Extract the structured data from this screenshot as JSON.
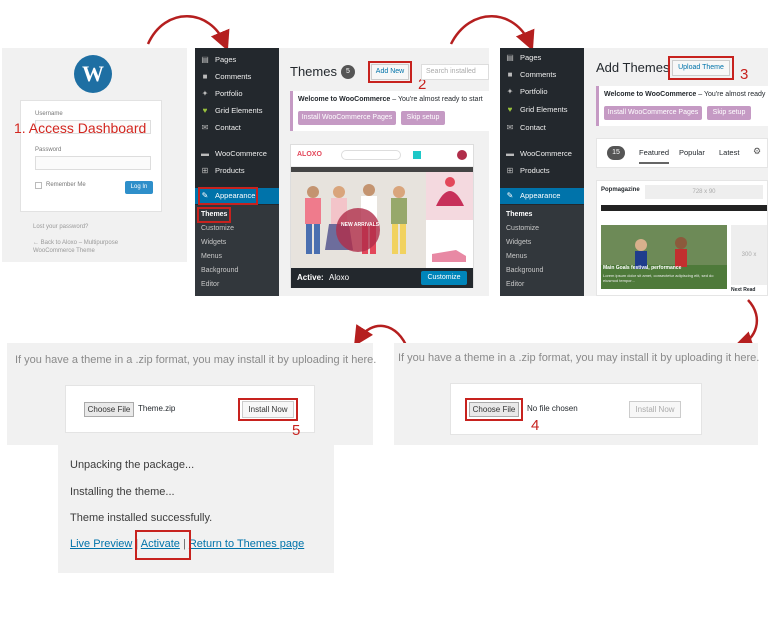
{
  "login": {
    "logo": "W",
    "username_label": "Username",
    "password_label": "Password",
    "remember_label": "Remember Me",
    "login_button": "Log In",
    "step_label": "1. Access Dashboard",
    "lost_password": "Lost your password?",
    "back_link": "← Back to Aloxo – Multipurpose WooCommerce Theme"
  },
  "sidebar1": {
    "items": [
      "Pages",
      "Comments",
      "Portfolio",
      "Grid Elements",
      "Contact",
      "WooCommerce",
      "Products",
      "Appearance"
    ],
    "sub_items": [
      "Themes",
      "Customize",
      "Widgets",
      "Menus",
      "Background",
      "Editor"
    ]
  },
  "sidebar2": {
    "items": [
      "Pages",
      "Comments",
      "Portfolio",
      "Grid Elements",
      "Contact",
      "WooCommerce",
      "Products",
      "Appearance"
    ],
    "sub_items": [
      "Themes",
      "Customize",
      "Widgets",
      "Menus",
      "Background",
      "Editor"
    ]
  },
  "themes_panel": {
    "title": "Themes",
    "count": "5",
    "add_new": "Add New",
    "search_placeholder": "Search installed",
    "step_num": "2",
    "welcome_bold": "Welcome to WooCommerce",
    "welcome_rest": " – You're almost ready to start",
    "install_pages": "Install WooCommerce Pages",
    "skip_setup": "Skip setup",
    "active_label": "Active:",
    "active_theme": "Aloxo",
    "customize": "Customize",
    "shop_logo": "ALOXO",
    "new_arrivals": "NEW ARRIVALS"
  },
  "add_themes_panel": {
    "title": "Add Themes",
    "upload_theme": "Upload Theme",
    "step_num": "3",
    "welcome_bold": "Welcome to WooCommerce",
    "welcome_rest": " – You're almost ready",
    "install_pages": "Install WooCommerce Pages",
    "skip_setup": "Skip setup",
    "count": "15",
    "tabs": [
      "Featured",
      "Popular",
      "Latest"
    ],
    "pm_logo": "Popmagazine",
    "ad1": "728 x 90",
    "ad2": "300 x",
    "news_headline": "Main Goals festival, performance",
    "news_text": "Lorem ipsum dolor sit amet, consectetur adipiscing elit, sed do eiusmod tempor...",
    "next_read": "Next Read"
  },
  "upload_left": {
    "text": "If you have a theme in a .zip format, you may install it by uploading it here.",
    "choose_file": "Choose File",
    "file_name": "Theme.zip",
    "install_now": "Install Now",
    "step_num": "5"
  },
  "upload_right": {
    "text": "If you have a theme in a .zip format, you may install it by uploading it here.",
    "choose_file": "Choose File",
    "file_name": "No file chosen",
    "install_now": "Install Now",
    "step_num": "4"
  },
  "result": {
    "line1": "Unpacking the package...",
    "line2": "Installing the theme...",
    "line3": "Theme installed successfully.",
    "live_preview": "Live Preview",
    "activate": "Activate",
    "return_link": "Return to Themes page",
    "sep": "|"
  },
  "colors": {
    "accent": "#0073aa",
    "highlight_red": "#c7221e",
    "woo_purple": "#c59ac4",
    "sidebar_dark": "#23282d"
  }
}
